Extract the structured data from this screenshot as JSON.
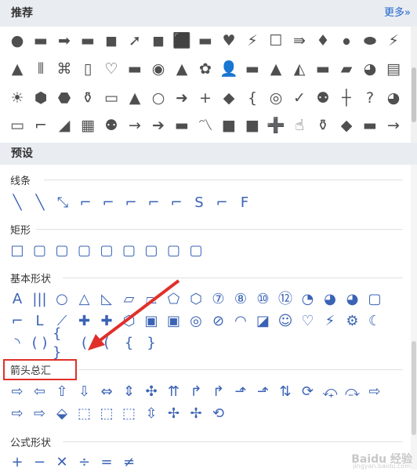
{
  "recommended": {
    "title": "推荐",
    "more": "更多»",
    "rows": [
      [
        "●",
        "▬",
        "➡",
        "▬",
        "◼",
        "➚",
        "◼",
        "⬛",
        "▬",
        "♥",
        "⚡",
        "☐",
        "⇛",
        "♦",
        "⦁",
        "⬬",
        "⚡"
      ],
      [
        "▲",
        "⦀",
        "⌘",
        "▯",
        "♡",
        "▬",
        "◉",
        "▲",
        "✿",
        "👤",
        "▬",
        "▲",
        "◭",
        "▬",
        "▰",
        "◕",
        "▤"
      ],
      [
        "☀",
        "⬢",
        "⬣",
        "⚱",
        "▭",
        "▲",
        "○",
        "➜",
        "+",
        "◆",
        "{",
        "◎",
        "✓",
        "⚉",
        "┼",
        "?",
        "◕"
      ],
      [
        "▭",
        "⌐",
        "◢",
        "▦",
        "⚉",
        "→",
        "➔",
        "▬",
        "〽",
        "■",
        "■",
        "➕",
        "☝",
        "⚱",
        "◆",
        "▬",
        "→"
      ]
    ]
  },
  "presets": {
    "title": "预设"
  },
  "categories": {
    "lines": "线条",
    "rect": "矩形",
    "basic": "基本形状",
    "arrows": "箭头总汇",
    "formula": "公式形状"
  },
  "line_shapes": [
    "╲",
    "╲",
    "⤡",
    "⌐",
    "⌐",
    "⌐",
    "⌐",
    "⌐",
    "S",
    "⌐",
    "ꓝ"
  ],
  "rect_shapes": [
    "□",
    "▢",
    "▢",
    "▢",
    "▢",
    "▢",
    "▢",
    "▢",
    "▢"
  ],
  "basic_row1": [
    "A",
    "|||",
    "○",
    "△",
    "◺",
    "▱",
    "⏢",
    "⬠",
    "⬡",
    "⑦",
    "⑧",
    "⑩",
    "⑫",
    "◔",
    "◕",
    "◕",
    "▢"
  ],
  "basic_row2": [
    "⌐",
    "L",
    "⟋",
    "✚",
    "✚",
    "⬡",
    "▣",
    "▣",
    "◎",
    "⊘",
    "◠",
    "◪",
    "☺",
    "♡",
    "⚡",
    "⚙",
    "☾"
  ],
  "basic_row3": [
    "◝",
    "( )",
    "{ }",
    "(",
    "(",
    "{",
    "}"
  ],
  "arrow_row1": [
    "⇨",
    "⇦",
    "⇧",
    "⇩",
    "⇔",
    "⇕",
    "✣",
    "⇈",
    "↱",
    "↱",
    "⬏",
    "⬏",
    "⇅",
    "⟳",
    "⤽",
    "⤼",
    "⇨"
  ],
  "arrow_row2": [
    "⇨",
    "⇨",
    "⬙",
    "⬚",
    "⬚",
    "⬚",
    "⇳",
    "✢",
    "✢",
    "⟲"
  ],
  "formula_row": [
    "+",
    "−",
    "✕",
    "÷",
    "=",
    "≠"
  ],
  "watermark": "Baidu 经验",
  "watermark_sub": "jingyan.baidu.com"
}
